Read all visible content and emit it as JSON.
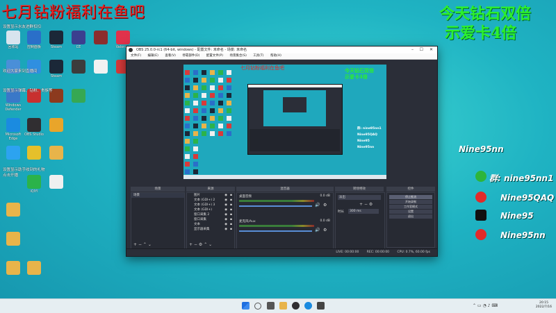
{
  "overlay": {
    "red_text": "七月钻粉福利在鱼吧",
    "green_line1": "今天钻石双倍",
    "green_line2": "示爱卡4倍"
  },
  "desktop": {
    "icons": [
      {
        "label": "回收站",
        "color": "#d8e4ee",
        "icon": "recycle-bin-icon"
      },
      {
        "label": "控制面板",
        "color": "#2a6fc9",
        "icon": "control-panel-icon"
      },
      {
        "label": "Steam",
        "color": "#1b2838",
        "icon": "steam-icon"
      },
      {
        "label": "CE",
        "color": "#3b3f8f",
        "icon": "cheat-engine-icon"
      },
      {
        "label": "",
        "color": "#8b2d2d",
        "icon": "pirate-icon"
      },
      {
        "label": "Valorant",
        "color": "#e0324b",
        "icon": "valorant-icon"
      },
      {
        "label": "",
        "color": "#4a8fd8",
        "icon": "app-icon"
      },
      {
        "label": "",
        "color": "#2f8fe0",
        "icon": "snowflake-icon"
      },
      {
        "label": "Steam",
        "color": "#1b2838",
        "icon": "steam-icon"
      },
      {
        "label": "",
        "color": "#3c3c3c",
        "icon": "lol-icon"
      },
      {
        "label": "",
        "color": "#f2f2f2",
        "icon": "app-icon"
      },
      {
        "label": "",
        "color": "#d83a3a",
        "icon": "app-icon"
      },
      {
        "label": "Windows Defender",
        "color": "#3a78c8",
        "icon": "shield-icon"
      },
      {
        "label": "",
        "color": "#c8302f",
        "icon": "app-icon"
      },
      {
        "label": "",
        "color": "#8c3a1e",
        "icon": "app-icon"
      },
      {
        "label": "",
        "color": "#36a853",
        "icon": "app-icon"
      },
      {
        "label": "Microsoft Edge",
        "color": "#1b8be0",
        "icon": "edge-icon"
      },
      {
        "label": "OBS Studio",
        "color": "#302e31",
        "icon": "obs-icon"
      },
      {
        "label": "",
        "color": "#e9a52a",
        "icon": "owl-icon"
      },
      {
        "label": "",
        "color": "#2ca3f0",
        "icon": "app-icon"
      },
      {
        "label": "",
        "color": "#e5c02b",
        "icon": "app-icon"
      },
      {
        "label": "",
        "color": "#e8b44a",
        "icon": "folder-icon"
      },
      {
        "label": "iQIYI",
        "color": "#2bb34a",
        "icon": "iqiyi-icon"
      },
      {
        "label": "",
        "color": "#f0f0f0",
        "icon": "file-icon"
      },
      {
        "label": "",
        "color": "#e8b44a",
        "icon": "folder-icon"
      },
      {
        "label": "",
        "color": "#e8b44a",
        "icon": "folder-icon"
      },
      {
        "label": "",
        "color": "#e8b44a",
        "icon": "folder-icon"
      },
      {
        "label": "",
        "color": "#e8b44a",
        "icon": "folder-icon"
      }
    ],
    "notes": [
      "设置显示水友进群扣扣",
      "欢迎大家来到直播间",
      "设置显示弹幕、钻粉、贵族等",
      "点击开播",
      "设置显示助手收到的礼物"
    ]
  },
  "obs": {
    "title": "OBS 25.0.0-rc1 (64-bit, windows) - 配置文件: 未命名 - 场景: 未命名",
    "menu": [
      "文件(F)",
      "编辑(E)",
      "查看(V)",
      "停靠部件(D)",
      "配置文件(P)",
      "场景集合(S)",
      "工具(T)",
      "帮助(H)"
    ],
    "docks": {
      "scenes_title": "场景",
      "sources_title": "来源",
      "mixer_title": "混音器",
      "transitions_title": "转场特效",
      "controls_title": "控件",
      "scenes": [
        "场景"
      ],
      "sources": [
        "图片",
        "文本 (GDI+) 2",
        "文本 (GDI+) 3",
        "文本 (GDI+)",
        "窗口采集 2",
        "窗口采集",
        "文本",
        "显示器采集"
      ],
      "mixer": [
        {
          "name": "桌面音频",
          "level": "0.0 dB"
        },
        {
          "name": "麦克风/Aux",
          "level": "0.0 dB"
        }
      ],
      "transition": {
        "type": "淡出",
        "duration_label": "时长",
        "duration_value": "300 ms"
      },
      "controls": [
        "停止推流",
        "开始录制",
        "工作室模式",
        "设置",
        "退出"
      ]
    },
    "status": {
      "live": "LIVE: 00:00:00",
      "rec": "REC: 00:00:00",
      "cpu": "CPU: 0.7%, 60.00 fps"
    }
  },
  "side_panel": {
    "streamer": "Nine95nn",
    "rows": [
      {
        "text": "群: nine95nn1",
        "color": "#2db53a",
        "icon": "wechat-icon"
      },
      {
        "text": "Nine95QAQ",
        "color": "#e22a2a",
        "icon": "weibo-icon"
      },
      {
        "text": "Nine95",
        "color": "#111111",
        "icon": "tiktok-icon"
      },
      {
        "text": "Nine95nn",
        "color": "#e22a2a",
        "icon": "netease-music-icon"
      }
    ]
  },
  "taskbar": {
    "time": "20:15",
    "date": "2022/7/16"
  }
}
